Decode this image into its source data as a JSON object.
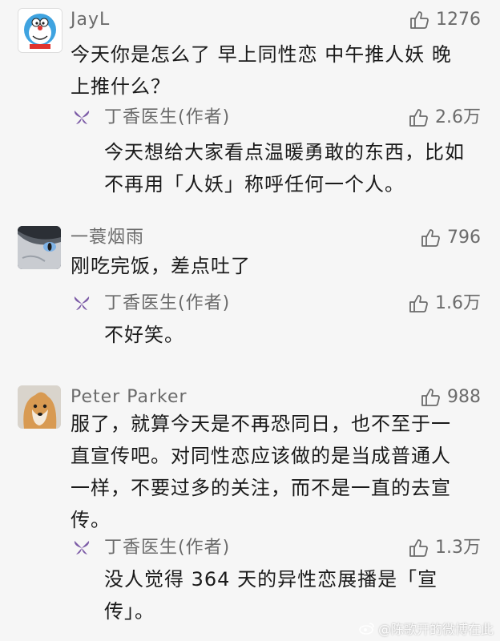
{
  "comments": [
    {
      "user": "JayL",
      "avatar": "doraemon-avatar",
      "likes": "1276",
      "lines": [
        "今天你是怎么了 早上同性恋 中午推人妖 晚",
        "上推什么？"
      ],
      "reply": {
        "user": "丁香医生(作者)",
        "likes": "2.6万",
        "lines": [
          "今天想给大家看点温暖勇敢的东西，比如",
          "不再用「人妖」称呼任何一个人。"
        ]
      }
    },
    {
      "user": "一蓑烟雨",
      "avatar": "cat-eye-avatar",
      "likes": "796",
      "lines": [
        "刚吃完饭，差点吐了"
      ],
      "reply": {
        "user": "丁香医生(作者)",
        "likes": "1.6万",
        "lines": [
          "不好笑。"
        ]
      }
    },
    {
      "user": "Peter Parker",
      "avatar": "shiba-dog-avatar",
      "likes": "988",
      "lines": [
        "服了，就算今天是不再恐同日，也不至于一",
        "直宣传吧。对同性恋应该做的是当成普通人",
        "一样，不要过多的关注，而不是一直的去宣",
        "传。"
      ],
      "reply": {
        "user": "丁香医生(作者)",
        "likes": "1.3万",
        "lines": [
          "没人觉得 364 天的异性恋展播是「宣",
          "传」。"
        ]
      }
    }
  ],
  "watermark": "@陈歌开的微博在此",
  "icons": {
    "like": "thumbs-up-icon",
    "author": "dingxiang-flower-icon",
    "weibo": "weibo-logo-icon"
  },
  "colors": {
    "background": "#f6f6f6",
    "meta_text": "#6b6b6b",
    "body_text": "#1a1a1a",
    "author_icon": "#7b5aa6"
  }
}
